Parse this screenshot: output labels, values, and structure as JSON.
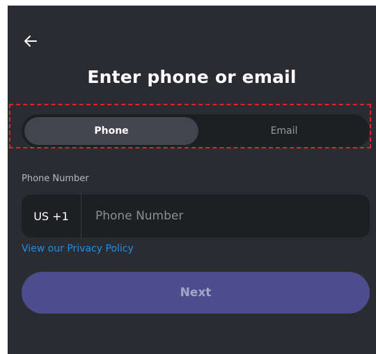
{
  "header": {
    "back_icon": "arrow-left-icon"
  },
  "title": "Enter phone or email",
  "tabs": [
    {
      "label": "Phone",
      "selected": true
    },
    {
      "label": "Email",
      "selected": false
    }
  ],
  "phone_field": {
    "label": "Phone Number",
    "country_code": "US +1",
    "value": "",
    "placeholder": "Phone Number"
  },
  "privacy_link": "View our Privacy Policy",
  "next_button": "Next",
  "colors": {
    "background": "#2b2c31",
    "input_background": "#1e1f22",
    "selected_tab": "#43444d",
    "link": "#1e90e8",
    "button": "#4b4d8e",
    "highlight_border": "#e1262b"
  }
}
